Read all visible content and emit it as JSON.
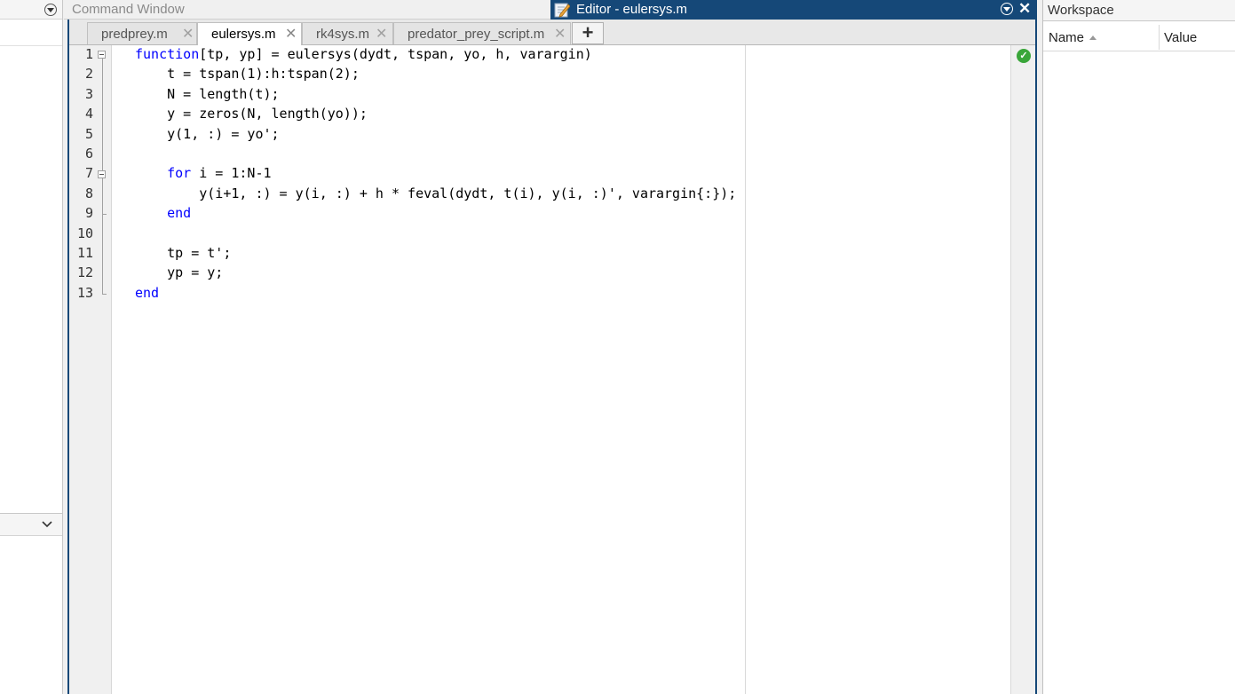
{
  "command_window": {
    "title": "Command Window"
  },
  "editor": {
    "title": "Editor - eulersys.m",
    "tabs": [
      {
        "label": "predprey.m",
        "active": false
      },
      {
        "label": "eulersys.m",
        "active": true
      },
      {
        "label": "rk4sys.m",
        "active": false
      },
      {
        "label": "predator_prey_script.m",
        "active": false
      }
    ],
    "add_tab_label": "+",
    "close_glyph": "✕",
    "code_lines": [
      {
        "n": "1",
        "parts": [
          [
            "kw",
            "function"
          ],
          [
            "",
            "[tp, yp] = eulersys(dydt, tspan, yo, h, varargin)"
          ]
        ]
      },
      {
        "n": "2",
        "parts": [
          [
            "",
            "    t = tspan(1):h:tspan(2);"
          ]
        ]
      },
      {
        "n": "3",
        "parts": [
          [
            "",
            "    N = length(t);"
          ]
        ]
      },
      {
        "n": "4",
        "parts": [
          [
            "",
            "    y = zeros(N, length(yo));"
          ]
        ]
      },
      {
        "n": "5",
        "parts": [
          [
            "",
            "    y(1, :) = yo';"
          ]
        ]
      },
      {
        "n": "6",
        "parts": [
          [
            "",
            ""
          ]
        ]
      },
      {
        "n": "7",
        "parts": [
          [
            "",
            "    "
          ],
          [
            "kw",
            "for"
          ],
          [
            "",
            " i = 1:N-1"
          ]
        ]
      },
      {
        "n": "8",
        "parts": [
          [
            "",
            "        y(i+1, :) = y(i, :) + h * feval(dydt, t(i), y(i, :)', varargin{:});"
          ]
        ]
      },
      {
        "n": "9",
        "parts": [
          [
            "",
            "    "
          ],
          [
            "kw",
            "end"
          ]
        ]
      },
      {
        "n": "10",
        "parts": [
          [
            "",
            ""
          ]
        ]
      },
      {
        "n": "11",
        "parts": [
          [
            "",
            "    tp = t';"
          ]
        ]
      },
      {
        "n": "12",
        "parts": [
          [
            "",
            "    yp = y;"
          ]
        ]
      },
      {
        "n": "13",
        "parts": [
          [
            "kw",
            "end"
          ]
        ]
      }
    ],
    "status": "ok",
    "colors": {
      "keyword": "#0000ff",
      "title_bar": "#154878",
      "status_ok": "#3aa63a"
    }
  },
  "workspace": {
    "title": "Workspace",
    "columns": [
      "Name",
      "Value"
    ],
    "sort_column": "Name",
    "sort_direction": "ascending"
  }
}
